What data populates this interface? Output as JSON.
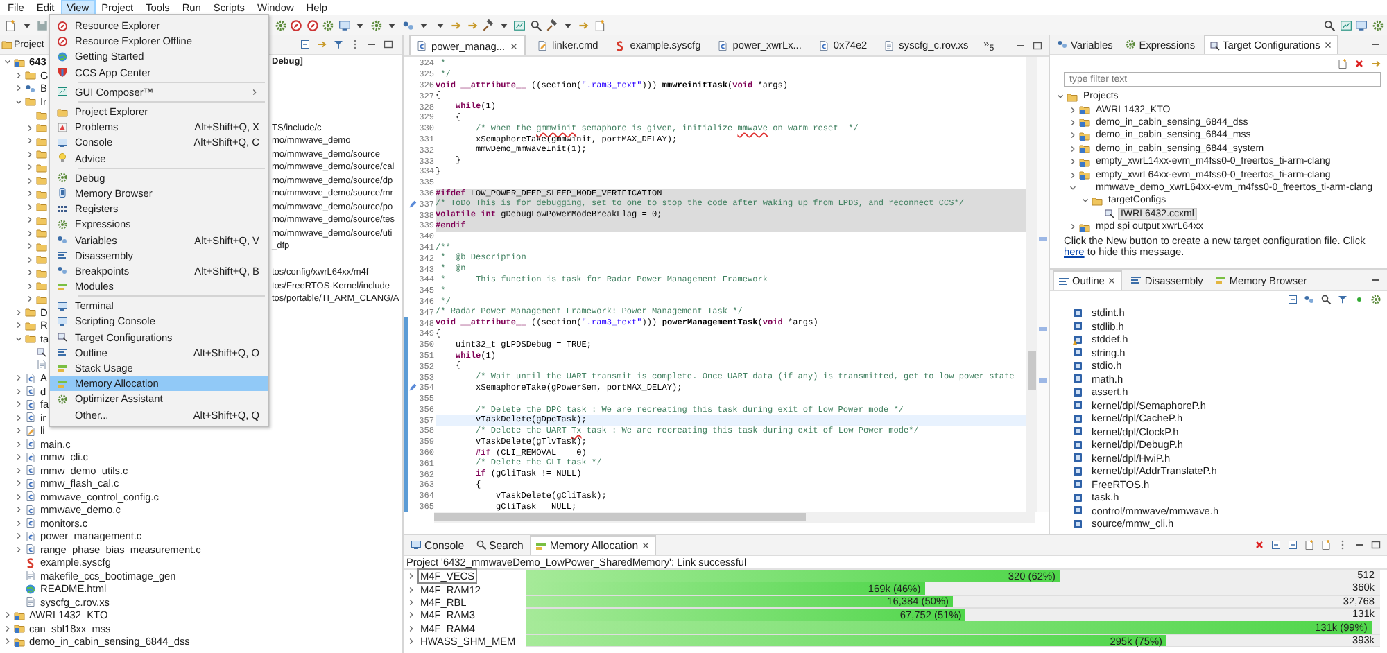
{
  "menubar": [
    {
      "label": "File",
      "selected": false
    },
    {
      "label": "Edit",
      "selected": false
    },
    {
      "label": "View",
      "selected": true
    },
    {
      "label": "Project",
      "selected": false
    },
    {
      "label": "Tools",
      "selected": false
    },
    {
      "label": "Run",
      "selected": false
    },
    {
      "label": "Scripts",
      "selected": false
    },
    {
      "label": "Window",
      "selected": false
    },
    {
      "label": "Help",
      "selected": false
    }
  ],
  "view_menu": [
    {
      "kind": "item",
      "label": "Resource Explorer",
      "selected": false
    },
    {
      "kind": "item",
      "label": "Resource Explorer Offline",
      "selected": false
    },
    {
      "kind": "item",
      "label": "Getting Started",
      "selected": false
    },
    {
      "kind": "item",
      "label": "CCS App Center",
      "selected": false
    },
    {
      "kind": "separator"
    },
    {
      "kind": "submenu",
      "label": "GUI Composer™",
      "selected": false
    },
    {
      "kind": "separator"
    },
    {
      "kind": "item",
      "label": "Project Explorer",
      "selected": false
    },
    {
      "kind": "item",
      "label": "Problems",
      "shortcut": "Alt+Shift+Q, X",
      "selected": false
    },
    {
      "kind": "item",
      "label": "Console",
      "shortcut": "Alt+Shift+Q, C",
      "selected": false
    },
    {
      "kind": "item",
      "label": "Advice",
      "selected": false
    },
    {
      "kind": "separator"
    },
    {
      "kind": "item",
      "label": "Debug",
      "selected": false
    },
    {
      "kind": "item",
      "label": "Memory Browser",
      "selected": false
    },
    {
      "kind": "item",
      "label": "Registers",
      "selected": false
    },
    {
      "kind": "item",
      "label": "Expressions",
      "selected": false
    },
    {
      "kind": "item",
      "label": "Variables",
      "shortcut": "Alt+Shift+Q, V",
      "selected": false
    },
    {
      "kind": "item",
      "label": "Disassembly",
      "selected": false
    },
    {
      "kind": "item",
      "label": "Breakpoints",
      "shortcut": "Alt+Shift+Q, B",
      "selected": false
    },
    {
      "kind": "item",
      "label": "Modules",
      "selected": false
    },
    {
      "kind": "separator"
    },
    {
      "kind": "item",
      "label": "Terminal",
      "selected": false
    },
    {
      "kind": "item",
      "label": "Scripting Console",
      "selected": false
    },
    {
      "kind": "item",
      "label": "Target Configurations",
      "selected": false
    },
    {
      "kind": "item",
      "label": "Outline",
      "shortcut": "Alt+Shift+Q, O",
      "selected": false
    },
    {
      "kind": "item",
      "label": "Stack Usage",
      "selected": false
    },
    {
      "kind": "item",
      "label": "Memory Allocation",
      "selected": true
    },
    {
      "kind": "item",
      "label": "Optimizer Assistant",
      "selected": false
    },
    {
      "kind": "item",
      "label": "Other...",
      "shortcut": "Alt+Shift+Q, Q",
      "selected": false
    }
  ],
  "project_explorer": {
    "tab": "Project",
    "tree": [
      {
        "label": "643",
        "tail": "Debug]",
        "kind": "project",
        "active": true,
        "expanded": true,
        "children": [
          {
            "label": "G",
            "kind": "folder",
            "expanded": false
          },
          {
            "label": "B",
            "kind": "binaries",
            "expanded": false
          },
          {
            "label": "Ir",
            "kind": "folder",
            "expanded": true,
            "children": [
              {
                "kind": "folder"
              },
              {
                "tail": "TS/include/c",
                "kind": "folder",
                "expanded": false
              },
              {
                "tail": "mo/mmwave_demo",
                "kind": "folder",
                "expanded": false
              },
              {
                "tail": "mo/mmwave_demo/source",
                "kind": "folder",
                "expanded": false
              },
              {
                "tail": "mo/mmwave_demo/source/cal",
                "kind": "folder",
                "expanded": false
              },
              {
                "tail": "mo/mmwave_demo/source/dp",
                "kind": "folder",
                "expanded": false
              },
              {
                "tail": "mo/mmwave_demo/source/mr",
                "kind": "folder",
                "expanded": false
              },
              {
                "tail": "mo/mmwave_demo/source/po",
                "kind": "folder",
                "expanded": false
              },
              {
                "tail": "mo/mmwave_demo/source/tes",
                "kind": "folder",
                "expanded": false
              },
              {
                "tail": "mo/mmwave_demo/source/uti",
                "kind": "folder",
                "expanded": false
              },
              {
                "tail": "_dfp",
                "kind": "folder",
                "expanded": false
              },
              {
                "kind": "folder",
                "expanded": false
              },
              {
                "tail": "tos/config/xwrL64xx/m4f",
                "kind": "folder",
                "expanded": false
              },
              {
                "tail": "tos/FreeRTOS-Kernel/include",
                "kind": "folder",
                "expanded": false
              },
              {
                "tail": "tos/portable/TI_ARM_CLANG/A",
                "kind": "folder",
                "expanded": false
              }
            ]
          },
          {
            "label": "D",
            "kind": "folder",
            "expanded": false
          },
          {
            "label": "R",
            "kind": "folder",
            "expanded": false
          },
          {
            "label": "ta",
            "kind": "folder",
            "expanded": true,
            "children": [
              {
                "kind": "config"
              },
              {
                "kind": "file"
              }
            ]
          },
          {
            "label": "A",
            "kind": "cfile",
            "expanded": false
          },
          {
            "label": "d",
            "kind": "cfile",
            "expanded": false
          },
          {
            "label": "fa",
            "kind": "cfile",
            "expanded": false
          },
          {
            "label": "ir",
            "kind": "cfile",
            "expanded": false
          },
          {
            "label": "li",
            "kind": "cmd",
            "expanded": false
          },
          {
            "label": "main.c",
            "kind": "cfile",
            "expanded": false
          },
          {
            "label": "mmw_cli.c",
            "kind": "cfile",
            "expanded": false
          },
          {
            "label": "mmw_demo_utils.c",
            "kind": "cfile",
            "expanded": false
          },
          {
            "label": "mmw_flash_cal.c",
            "kind": "cfile",
            "expanded": false
          },
          {
            "label": "mmwave_control_config.c",
            "kind": "cfile",
            "expanded": false
          },
          {
            "label": "mmwave_demo.c",
            "kind": "cfile",
            "expanded": false
          },
          {
            "label": "monitors.c",
            "kind": "cfile",
            "expanded": false
          },
          {
            "label": "power_management.c",
            "kind": "cfile",
            "expanded": false
          },
          {
            "label": "range_phase_bias_measurement.c",
            "kind": "cfile",
            "expanded": false
          },
          {
            "label": "example.syscfg",
            "kind": "syscfg"
          },
          {
            "label": "makefile_ccs_bootimage_gen",
            "kind": "file"
          },
          {
            "label": "README.html",
            "kind": "web"
          },
          {
            "label": "syscfg_c.rov.xs",
            "kind": "file"
          }
        ]
      },
      {
        "label": "AWRL1432_KTO",
        "kind": "project",
        "active": false,
        "expanded": false
      },
      {
        "label": "can_sbl18xx_mss",
        "kind": "project",
        "active": false,
        "expanded": false
      },
      {
        "label": "demo_in_cabin_sensing_6844_dss",
        "kind": "project",
        "active": false,
        "expanded": false
      }
    ]
  },
  "editor": {
    "tabs": [
      {
        "label": "power_manag...",
        "kind": "cfile",
        "selected": true
      },
      {
        "label": "linker.cmd",
        "kind": "cmd",
        "selected": false
      },
      {
        "label": "example.syscfg",
        "kind": "syscfg",
        "selected": false
      },
      {
        "label": "power_xwrLx...",
        "kind": "cfile",
        "selected": false
      },
      {
        "label": "0x74e2",
        "kind": "cfile",
        "selected": false
      },
      {
        "label": "syscfg_c.rov.xs",
        "kind": "file",
        "selected": false
      }
    ],
    "overflow": "»$_{5}$",
    "lines": [
      {
        "n": "324",
        "segs": [
          {
            "kind": "c",
            "text": " *"
          }
        ]
      },
      {
        "n": "325",
        "segs": [
          {
            "kind": "c",
            "text": " */"
          }
        ]
      },
      {
        "n": "326",
        "segs": [
          {
            "kind": "kw",
            "text": "void __attribute__"
          },
          {
            "kind": "p",
            "text": " ((section("
          },
          {
            "kind": "s",
            "text": "\".ram3_text\""
          },
          {
            "kind": "p",
            "text": "))) "
          },
          {
            "kind": "fn",
            "text": "mmwreinitTask"
          },
          {
            "kind": "p",
            "text": "("
          },
          {
            "kind": "kw",
            "text": "void"
          },
          {
            "kind": "p",
            "text": " *args)"
          }
        ]
      },
      {
        "n": "327",
        "segs": [
          {
            "kind": "p",
            "text": "{"
          }
        ]
      },
      {
        "n": "328",
        "segs": [
          {
            "kind": "kw",
            "text": "    while"
          },
          {
            "kind": "p",
            "text": "(1)"
          }
        ]
      },
      {
        "n": "329",
        "segs": [
          {
            "kind": "p",
            "text": "    {"
          }
        ]
      },
      {
        "n": "330",
        "segs": [
          {
            "kind": "c",
            "text": "        /* when the "
          },
          {
            "kind": "sp",
            "text": "gmmwinit"
          },
          {
            "kind": "c",
            "text": " semaphore is given, initialize "
          },
          {
            "kind": "sp",
            "text": "mmwave"
          },
          {
            "kind": "c",
            "text": " on warm reset  */"
          }
        ]
      },
      {
        "n": "331",
        "segs": [
          {
            "kind": "p",
            "text": "        xSemaphoreTake(gmmwinit, portMAX_DELAY);"
          }
        ]
      },
      {
        "n": "332",
        "segs": [
          {
            "kind": "p",
            "text": "        mmwDemo_mmWaveInit(1);"
          }
        ]
      },
      {
        "n": "333",
        "segs": [
          {
            "kind": "p",
            "text": "    }"
          }
        ]
      },
      {
        "n": "334",
        "segs": [
          {
            "kind": "p",
            "text": "}"
          }
        ]
      },
      {
        "n": "335"
      },
      {
        "n": "336",
        "inactive": true,
        "segs": [
          {
            "kind": "pp",
            "text": "#ifdef"
          },
          {
            "kind": "p",
            "text": " LOW_POWER_DEEP_SLEEP_MODE_VERIFICATION"
          }
        ]
      },
      {
        "n": "337",
        "inactive": true,
        "marker": true,
        "segs": [
          {
            "kind": "c",
            "text": "/* ToDo This is for debugging, set to one to stop the code after waking up from LPDS, and reconnect CCS*/"
          }
        ]
      },
      {
        "n": "338",
        "inactive": true,
        "segs": [
          {
            "kind": "kw",
            "text": "volatile int"
          },
          {
            "kind": "p",
            "text": " gDebugLowPowerModeBreakFlag = 0;"
          }
        ]
      },
      {
        "n": "339",
        "inactive": true,
        "segs": [
          {
            "kind": "pp",
            "text": "#endif"
          }
        ]
      },
      {
        "n": "340"
      },
      {
        "n": "341",
        "segs": [
          {
            "kind": "c",
            "text": "/**"
          }
        ]
      },
      {
        "n": "342",
        "segs": [
          {
            "kind": "c",
            "text": " *  @b Description"
          }
        ]
      },
      {
        "n": "343",
        "segs": [
          {
            "kind": "c",
            "text": " *  @n"
          }
        ]
      },
      {
        "n": "344",
        "segs": [
          {
            "kind": "c",
            "text": " *      This function is task for Radar Power Management Framework"
          }
        ]
      },
      {
        "n": "345",
        "segs": [
          {
            "kind": "c",
            "text": " *"
          }
        ]
      },
      {
        "n": "346",
        "segs": [
          {
            "kind": "c",
            "text": " */"
          }
        ]
      },
      {
        "n": "347",
        "segs": [
          {
            "kind": "c",
            "text": "/* Radar Power Management Framework: Power Management Task */"
          }
        ]
      },
      {
        "n": "348",
        "scope": true,
        "segs": [
          {
            "kind": "kw",
            "text": "void __attribute__"
          },
          {
            "kind": "p",
            "text": " ((section("
          },
          {
            "kind": "s",
            "text": "\".ram3_text\""
          },
          {
            "kind": "p",
            "text": "))) "
          },
          {
            "kind": "fn",
            "text": "powerManagementTask"
          },
          {
            "kind": "p",
            "text": "("
          },
          {
            "kind": "kw",
            "text": "void"
          },
          {
            "kind": "p",
            "text": " *args)"
          }
        ]
      },
      {
        "n": "349",
        "scope": true,
        "segs": [
          {
            "kind": "p",
            "text": "{"
          }
        ]
      },
      {
        "n": "350",
        "scope": true,
        "segs": [
          {
            "kind": "p",
            "text": "    uint32_t gLPDSDebug = TRUE;"
          }
        ]
      },
      {
        "n": "351",
        "scope": true,
        "segs": [
          {
            "kind": "kw",
            "text": "    while"
          },
          {
            "kind": "p",
            "text": "(1)"
          }
        ]
      },
      {
        "n": "352",
        "scope": true,
        "segs": [
          {
            "kind": "p",
            "text": "    {"
          }
        ]
      },
      {
        "n": "353",
        "scope": true,
        "segs": [
          {
            "kind": "c",
            "text": "        /* Wait until the UART transmit is complete. Once UART data (if any) is transmitted, get to low power state"
          }
        ]
      },
      {
        "n": "354",
        "scope": true,
        "marker": true,
        "segs": [
          {
            "kind": "p",
            "text": "        xSemaphoreTake(gPowerSem, portMAX_DELAY);"
          }
        ]
      },
      {
        "n": "355",
        "scope": true
      },
      {
        "n": "356",
        "scope": true,
        "segs": [
          {
            "kind": "c",
            "text": "        /* Delete the DPC task : We are recreating this task during exit of Low Power mode */"
          }
        ]
      },
      {
        "n": "357",
        "scope": true,
        "current": true,
        "segs": [
          {
            "kind": "p",
            "text": "        vTaskDelete(gDpcTask);"
          }
        ]
      },
      {
        "n": "358",
        "scope": true,
        "segs": [
          {
            "kind": "c",
            "text": "        /* Delete the UART "
          },
          {
            "kind": "sp",
            "text": "Tx"
          },
          {
            "kind": "c",
            "text": " task : We are recreating this task during exit of Low Power mode*/"
          }
        ]
      },
      {
        "n": "359",
        "scope": true,
        "segs": [
          {
            "kind": "p",
            "text": "        vTaskDelete(gTlvTask);"
          }
        ]
      },
      {
        "n": "360",
        "scope": true,
        "segs": [
          {
            "kind": "pp",
            "text": "        #if"
          },
          {
            "kind": "p",
            "text": " (CLI_REMOVAL == 0)"
          }
        ]
      },
      {
        "n": "361",
        "scope": true,
        "segs": [
          {
            "kind": "c",
            "text": "        /* Delete the CLI task */"
          }
        ]
      },
      {
        "n": "362",
        "scope": true,
        "segs": [
          {
            "kind": "kw",
            "text": "        if"
          },
          {
            "kind": "p",
            "text": " (gCliTask != NULL)"
          }
        ]
      },
      {
        "n": "363",
        "scope": true,
        "segs": [
          {
            "kind": "p",
            "text": "        {"
          }
        ]
      },
      {
        "n": "364",
        "scope": true,
        "segs": [
          {
            "kind": "p",
            "text": "            vTaskDelete(gCliTask);"
          }
        ]
      },
      {
        "n": "365",
        "scope": true,
        "segs": [
          {
            "kind": "p",
            "text": "            gCliTask = NULL;"
          }
        ]
      }
    ]
  },
  "target_configurations": {
    "tabs": [
      {
        "label": "Variables",
        "kind": "variables",
        "selected": false
      },
      {
        "label": "Expressions",
        "kind": "expressions",
        "selected": false
      },
      {
        "label": "Target Configurations",
        "kind": "config",
        "selected": true
      }
    ],
    "filter": {
      "placeholder": "type filter text"
    },
    "tree": [
      {
        "label": "Projects",
        "kind": "folder",
        "expanded": true,
        "selected": false,
        "children": [
          {
            "label": "AWRL1432_KTO",
            "kind": "project",
            "expanded": false,
            "selected": false
          },
          {
            "label": "demo_in_cabin_sensing_6844_dss",
            "kind": "project",
            "expanded": false,
            "selected": false
          },
          {
            "label": "demo_in_cabin_sensing_6844_mss",
            "kind": "project",
            "expanded": false,
            "selected": false
          },
          {
            "label": "demo_in_cabin_sensing_6844_system",
            "kind": "project",
            "expanded": false,
            "selected": false
          },
          {
            "label": "empty_xwrL14xx-evm_m4fss0-0_freertos_ti-arm-clang",
            "kind": "project",
            "expanded": false,
            "selected": false
          },
          {
            "label": "empty_xwrL64xx-evm_m4fss0-0_freertos_ti-arm-clang",
            "kind": "project",
            "expanded": false,
            "selected": false
          },
          {
            "label": "mmwave_demo_xwrL64xx-evm_m4fss0-0_freertos_ti-arm-clang",
            "kind": "plain",
            "expanded": true,
            "selected": false,
            "children": [
              {
                "label": "targetConfigs",
                "kind": "folder",
                "expanded": true,
                "selected": false,
                "children": [
                  {
                    "label": "IWRL6432.ccxml",
                    "kind": "config",
                    "selected": true
                  }
                ]
              }
            ]
          },
          {
            "label": "mpd spi output xwrL64xx",
            "kind": "project",
            "expanded": false,
            "selected": false
          }
        ]
      }
    ],
    "message": "Click the New button to create a new target configuration file. Click ",
    "link": "here",
    "message_end": " to hide this message."
  },
  "outline": {
    "tabs": [
      {
        "label": "Outline",
        "kind": "outline",
        "selected": true
      },
      {
        "label": "Disassembly",
        "kind": "disassembly",
        "selected": false
      },
      {
        "label": "Memory Browser",
        "kind": "memory",
        "selected": false
      }
    ],
    "items": [
      {
        "label": "stdint.h",
        "kind": "header"
      },
      {
        "label": "stdlib.h",
        "kind": "header"
      },
      {
        "label": "stddef.h",
        "kind": "header-warning"
      },
      {
        "label": "string.h",
        "kind": "header"
      },
      {
        "label": "stdio.h",
        "kind": "header"
      },
      {
        "label": "math.h",
        "kind": "header"
      },
      {
        "label": "assert.h",
        "kind": "header"
      },
      {
        "label": "kernel/dpl/SemaphoreP.h",
        "kind": "header"
      },
      {
        "label": "kernel/dpl/CacheP.h",
        "kind": "header"
      },
      {
        "label": "kernel/dpl/ClockP.h",
        "kind": "header"
      },
      {
        "label": "kernel/dpl/DebugP.h",
        "kind": "header"
      },
      {
        "label": "kernel/dpl/HwiP.h",
        "kind": "header"
      },
      {
        "label": "kernel/dpl/AddrTranslateP.h",
        "kind": "header"
      },
      {
        "label": "FreeRTOS.h",
        "kind": "header"
      },
      {
        "label": "task.h",
        "kind": "header"
      },
      {
        "label": "control/mmwave/mmwave.h",
        "kind": "header"
      },
      {
        "label": "source/mmw_cli.h",
        "kind": "header"
      }
    ]
  },
  "bottom_panel": {
    "tabs": [
      {
        "label": "Console",
        "kind": "console",
        "selected": false
      },
      {
        "label": "Search",
        "kind": "search",
        "selected": false
      },
      {
        "label": "Memory Allocation",
        "kind": "memory",
        "selected": true
      }
    ],
    "status": "Project '6432_mmwaveDemo_LowPower_SharedMemory': Link successful",
    "memory": [
      {
        "name": "M4F_VECS",
        "used": "320 (62%)",
        "total": "512",
        "level": 0.625,
        "selected": true
      },
      {
        "name": "M4F_RAM12",
        "used": "169k (46%)",
        "total": "360k",
        "level": 0.467,
        "selected": false
      },
      {
        "name": "M4F_RBL",
        "used": "16,384 (50%)",
        "total": "32,768",
        "level": 0.5,
        "selected": false
      },
      {
        "name": "M4F_RAM3",
        "used": "67,752 (51%)",
        "total": "131k",
        "level": 0.515,
        "selected": false
      },
      {
        "name": "M4F_RAM4",
        "used": "131k (99%)",
        "level": 0.99,
        "selected": false
      },
      {
        "name": "HWASS_SHM_MEM",
        "used": "295k (75%)",
        "total": "393k",
        "level": 0.75,
        "selected": false
      }
    ]
  }
}
